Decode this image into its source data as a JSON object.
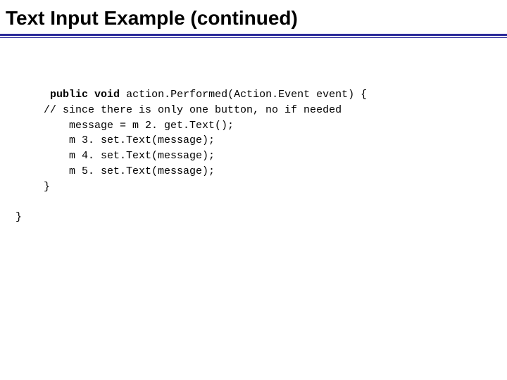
{
  "title": "Text Input Example (continued)",
  "code": {
    "kw_public": "public",
    "kw_void": "void",
    "sig_rest": " action.Performed(Action.Event event) {",
    "comment": "// since there is only one button, no if needed",
    "l1": "    message = m 2. get.Text();",
    "l2": "    m 3. set.Text(message);",
    "l3": "    m 4. set.Text(message);",
    "l4": "    m 5. set.Text(message);",
    "close_inner": "}",
    "close_outer": "}"
  }
}
